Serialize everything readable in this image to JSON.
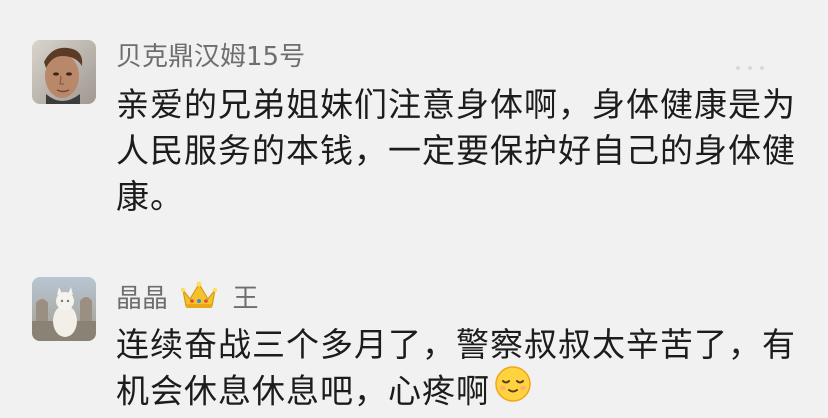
{
  "comments": [
    {
      "author": "贝克鼎汉姆15号",
      "lines": [
        "亲爱的兄弟姐妹们注意身体啊，身体健康是为",
        "人民服务的本钱，一定要保护好自己的身体健",
        "康。"
      ]
    },
    {
      "author": "晶晶",
      "author_suffix": "王",
      "lines": [
        "连续奋战三个多月了，警察叔叔太辛苦了，有",
        "机会休息休息吧，心疼啊"
      ]
    }
  ],
  "icons": {
    "badge": "crown-icon",
    "emoji": "relieved-face-emoji-icon"
  },
  "colors": {
    "background": "#f1f1f1",
    "username": "#6e6e6e",
    "text": "#1c1c1c"
  }
}
